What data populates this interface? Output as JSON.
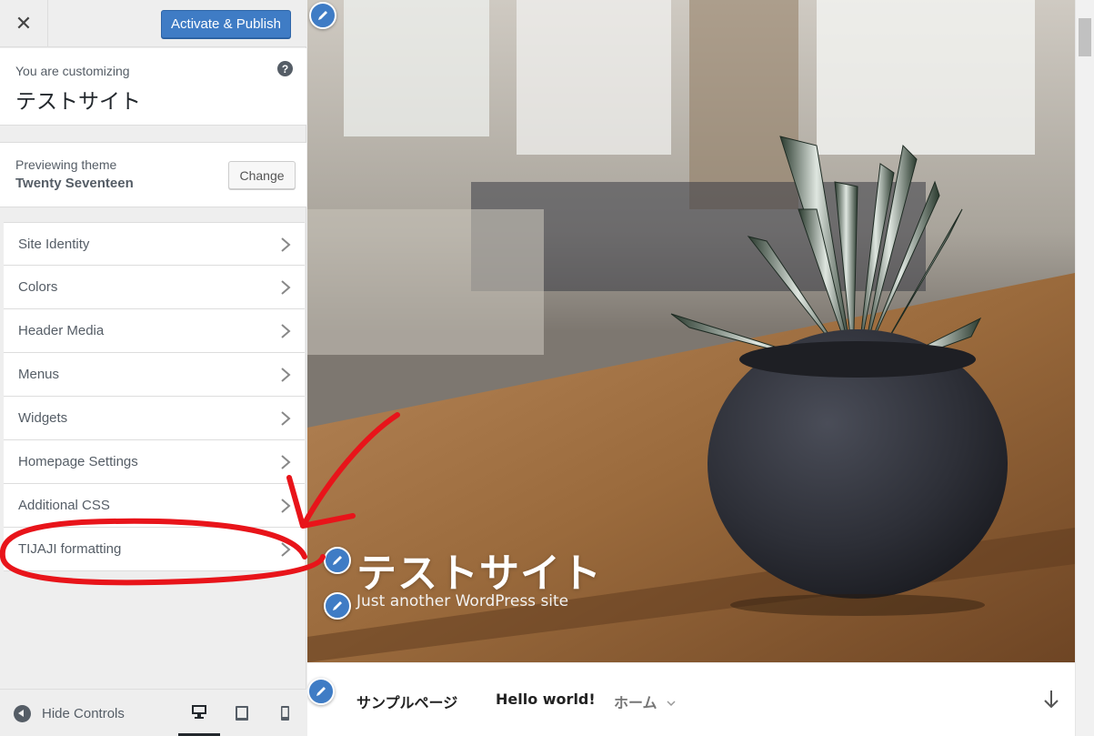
{
  "header": {
    "close_label": "✕",
    "publish_label": "Activate & Publish"
  },
  "info": {
    "subtitle": "You are customizing",
    "site_name": "テストサイト",
    "help_label": "?"
  },
  "theme": {
    "subtitle": "Previewing theme",
    "name": "Twenty Seventeen",
    "change_label": "Change"
  },
  "sections": [
    {
      "label": "Site Identity"
    },
    {
      "label": "Colors"
    },
    {
      "label": "Header Media"
    },
    {
      "label": "Menus"
    },
    {
      "label": "Widgets"
    },
    {
      "label": "Homepage Settings"
    },
    {
      "label": "Additional CSS"
    },
    {
      "label": "TIJAJI formatting"
    }
  ],
  "footer": {
    "hide_label": "Hide Controls",
    "devices": [
      "desktop-icon",
      "tablet-icon",
      "mobile-icon"
    ]
  },
  "preview": {
    "site_title": "テストサイト",
    "tagline": "Just another WordPress site",
    "nav": [
      {
        "label": "サンプルページ"
      },
      {
        "label": "Hello world!"
      },
      {
        "label": "ホーム"
      }
    ]
  },
  "colors": {
    "accent": "#3f7cc5",
    "annotation": "#e8141a"
  }
}
